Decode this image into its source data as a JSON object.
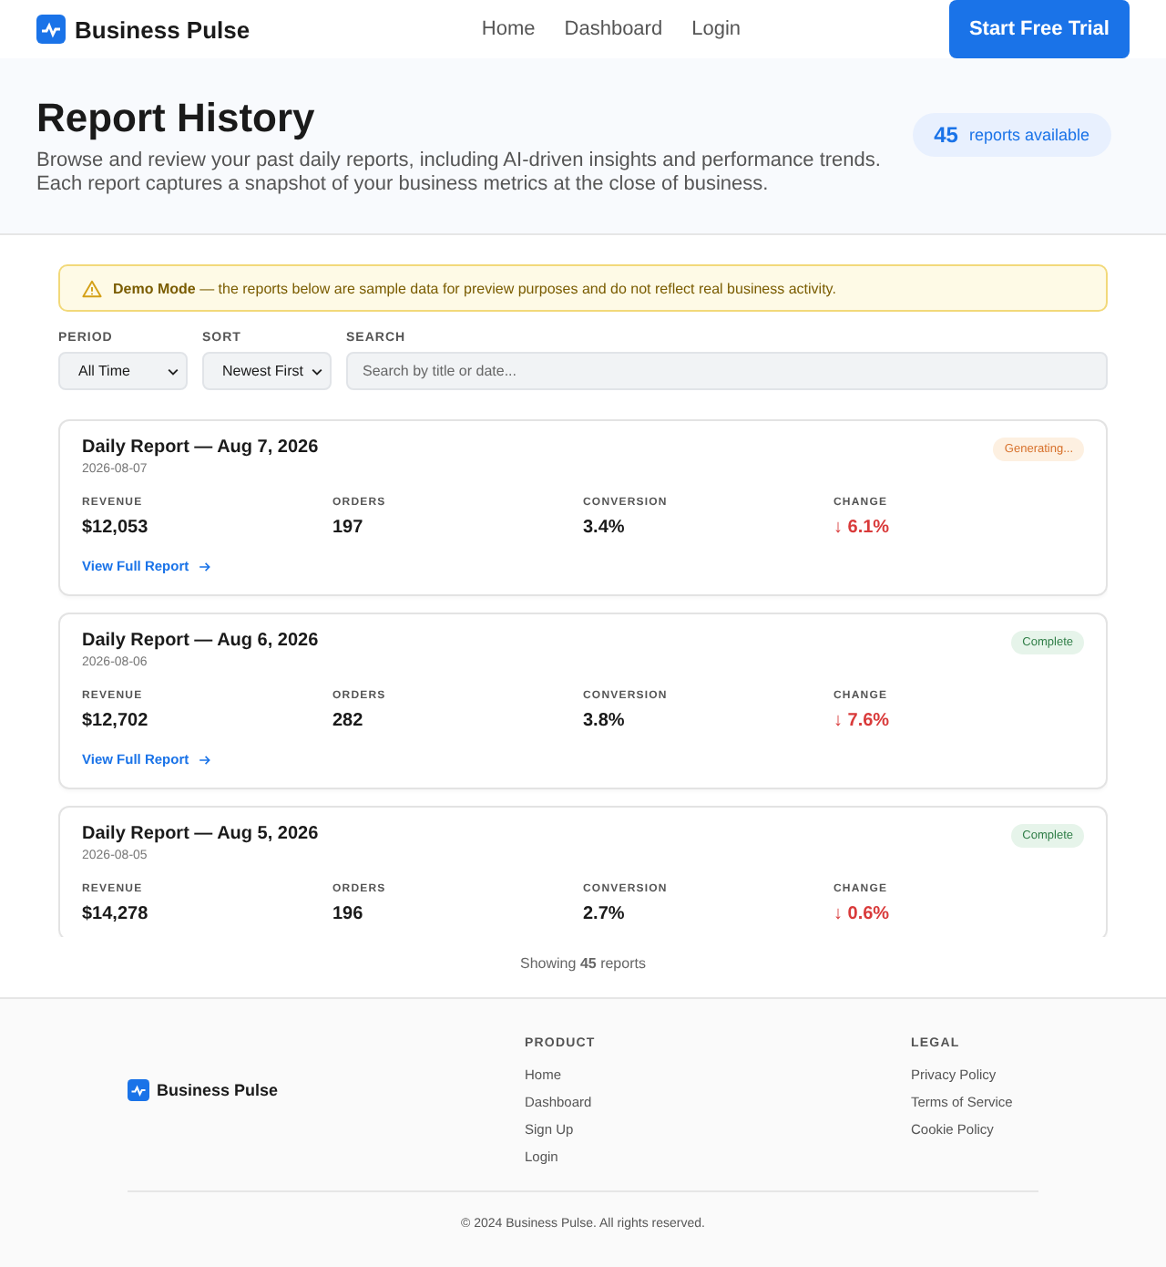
{
  "nav": {
    "brand": "Business Pulse",
    "links": [
      "Home",
      "Dashboard",
      "Login"
    ],
    "cta": "Start Free Trial"
  },
  "hero": {
    "title": "Report History",
    "lines": [
      "Browse and review your past daily reports, including AI-driven insights and performance trends.",
      "Each report captures a snapshot of your business metrics at the close of business."
    ],
    "count": "45",
    "count_label": "reports available"
  },
  "banner": {
    "text": "**Demo Mode** — the reports below are sample data for preview purposes and do not reflect real business activity."
  },
  "filters": {
    "period": {
      "label": "PERIOD",
      "value": "All Time"
    },
    "sort": {
      "label": "SORT",
      "value": "Newest First"
    },
    "search": {
      "label": "SEARCH",
      "placeholder": "Search by title or date..."
    }
  },
  "reports": [
    {
      "title": "Daily Report — Aug 7, 2026",
      "date": "2026-08-07",
      "status": {
        "kind": "generating",
        "label": "Generating..."
      },
      "metrics": [
        {
          "label": "REVENUE",
          "value": "$12,053"
        },
        {
          "label": "ORDERS",
          "value": "197"
        },
        {
          "label": "CONVERSION",
          "value": "3.4%"
        },
        {
          "label": "CHANGE",
          "value": "↓ 6.1%",
          "kind": "down"
        }
      ],
      "link": "View Full Report"
    },
    {
      "title": "Daily Report — Aug 6, 2026",
      "date": "2026-08-06",
      "status": {
        "kind": "complete",
        "label": "Complete"
      },
      "metrics": [
        {
          "label": "REVENUE",
          "value": "$12,702"
        },
        {
          "label": "ORDERS",
          "value": "282"
        },
        {
          "label": "CONVERSION",
          "value": "3.8%"
        },
        {
          "label": "CHANGE",
          "value": "↓ 7.6%",
          "kind": "down"
        }
      ],
      "link": "View Full Report"
    },
    {
      "title": "Daily Report — Aug 5, 2026",
      "date": "2026-08-05",
      "status": {
        "kind": "complete",
        "label": "Complete"
      },
      "metrics": [
        {
          "label": "REVENUE",
          "value": "$14,278"
        },
        {
          "label": "ORDERS",
          "value": "196"
        },
        {
          "label": "CONVERSION",
          "value": "2.7%"
        },
        {
          "label": "CHANGE",
          "value": "↓ 0.6%",
          "kind": "down"
        }
      ]
    }
  ],
  "showing": "Showing **45** reports",
  "footer": {
    "brand": "Business Pulse",
    "columns": [
      {
        "heading": "PRODUCT",
        "links": [
          "Home",
          "Dashboard",
          "Sign Up",
          "Login"
        ]
      },
      {
        "heading": "LEGAL",
        "links": [
          "Privacy Policy",
          "Terms of Service",
          "Cookie Policy"
        ]
      }
    ],
    "copyright": "© 2024 Business Pulse. All rights reserved."
  }
}
